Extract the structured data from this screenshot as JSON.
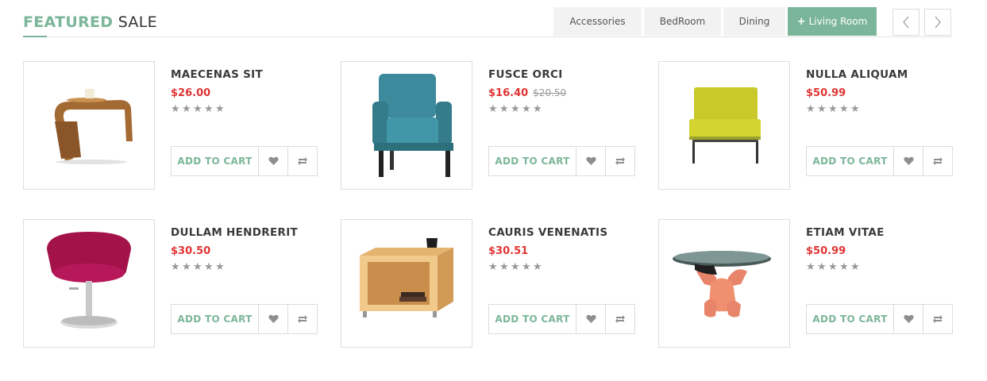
{
  "section": {
    "title_strong": "FEATURED",
    "title_light": "SALE"
  },
  "tabs": [
    {
      "label": "Accessories",
      "active": false
    },
    {
      "label": "BedRoom",
      "active": false
    },
    {
      "label": "Dining",
      "active": false
    },
    {
      "label": "Living Room",
      "active": true
    }
  ],
  "nav": {
    "prev_icon": "chevron-left-icon",
    "next_icon": "chevron-right-icon"
  },
  "accent_color": "#7cb69a",
  "price_color": "#e03333",
  "products": [
    {
      "name": "MAECENAS SIT",
      "price": "$26.00",
      "old_price": "",
      "rating": 0,
      "cart_label": "ADD TO CART",
      "image": "wooden-side-table"
    },
    {
      "name": "FUSCE ORCI",
      "price": "$16.40",
      "old_price": "$20.50",
      "rating": 0,
      "cart_label": "ADD TO CART",
      "image": "teal-armchair"
    },
    {
      "name": "NULLA ALIQUAM",
      "price": "$50.99",
      "old_price": "",
      "rating": 0,
      "cart_label": "ADD TO CART",
      "image": "yellow-chair"
    },
    {
      "name": "DULLAM HENDRERIT",
      "price": "$30.50",
      "old_price": "",
      "rating": 0,
      "cart_label": "ADD TO CART",
      "image": "red-swivel-chair"
    },
    {
      "name": "CAURIS VENENATIS",
      "price": "$30.51",
      "old_price": "",
      "rating": 0,
      "cart_label": "ADD TO CART",
      "image": "wooden-cube-table"
    },
    {
      "name": "ETIAM VITAE",
      "price": "$50.99",
      "old_price": "",
      "rating": 0,
      "cart_label": "ADD TO CART",
      "image": "glass-coffee-table"
    }
  ]
}
